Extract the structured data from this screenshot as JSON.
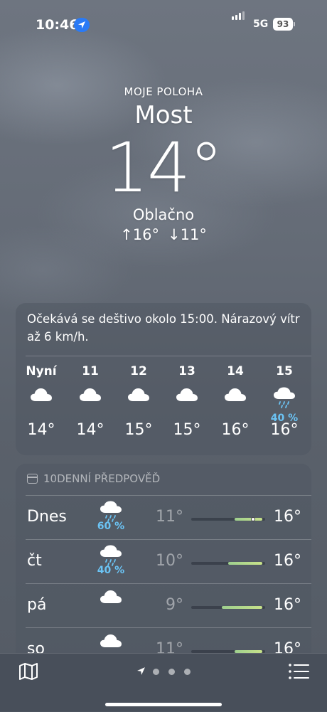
{
  "status": {
    "time": "10:46",
    "network": "5G",
    "battery": "93"
  },
  "header": {
    "location_label": "MOJE POLOHA",
    "city": "Most",
    "temperature": "14°",
    "condition": "Oblačno",
    "high": "↑16°",
    "low": "↓11°"
  },
  "hourly": {
    "summary": "Očekává se deštivo okolo 15:00. Nárazový vítr až 6 km/h.",
    "items": [
      {
        "label": "Nyní",
        "icon": "cloud-icon",
        "temp": "14°"
      },
      {
        "label": "11",
        "icon": "cloud-icon",
        "temp": "14°"
      },
      {
        "label": "12",
        "icon": "cloud-icon",
        "temp": "15°"
      },
      {
        "label": "13",
        "icon": "cloud-icon",
        "temp": "15°"
      },
      {
        "label": "14",
        "icon": "cloud-icon",
        "temp": "16°"
      },
      {
        "label": "15",
        "icon": "cloud-rain-icon",
        "precip": "40 %",
        "temp": "16°"
      }
    ]
  },
  "daily": {
    "title": "10DENNÍ PŘEDPOVĚĎ",
    "range_min": 9,
    "range_max": 16,
    "days": [
      {
        "name": "Dnes",
        "icon": "cloud-rain-icon",
        "precip": "60 %",
        "low": "11°",
        "high": "16°",
        "low_value": 11,
        "high_value": 16,
        "current_value": 14
      },
      {
        "name": "čt",
        "icon": "cloud-rain-icon",
        "precip": "40 %",
        "low": "10°",
        "high": "16°",
        "low_value": 10,
        "high_value": 16
      },
      {
        "name": "pá",
        "icon": "cloud-icon",
        "precip": "",
        "low": "9°",
        "high": "16°",
        "low_value": 9,
        "high_value": 16
      },
      {
        "name": "so",
        "icon": "cloud-icon",
        "precip": "",
        "low": "11°",
        "high": "16°",
        "low_value": 11,
        "high_value": 16
      }
    ]
  },
  "colors": {
    "precip": "#6bc4f5",
    "location_pill": "#2a7af5"
  },
  "bottom_bar": {
    "map_icon": "map-icon",
    "location_icon": "location-arrow-icon",
    "list_icon": "list-icon",
    "pages": 3
  }
}
